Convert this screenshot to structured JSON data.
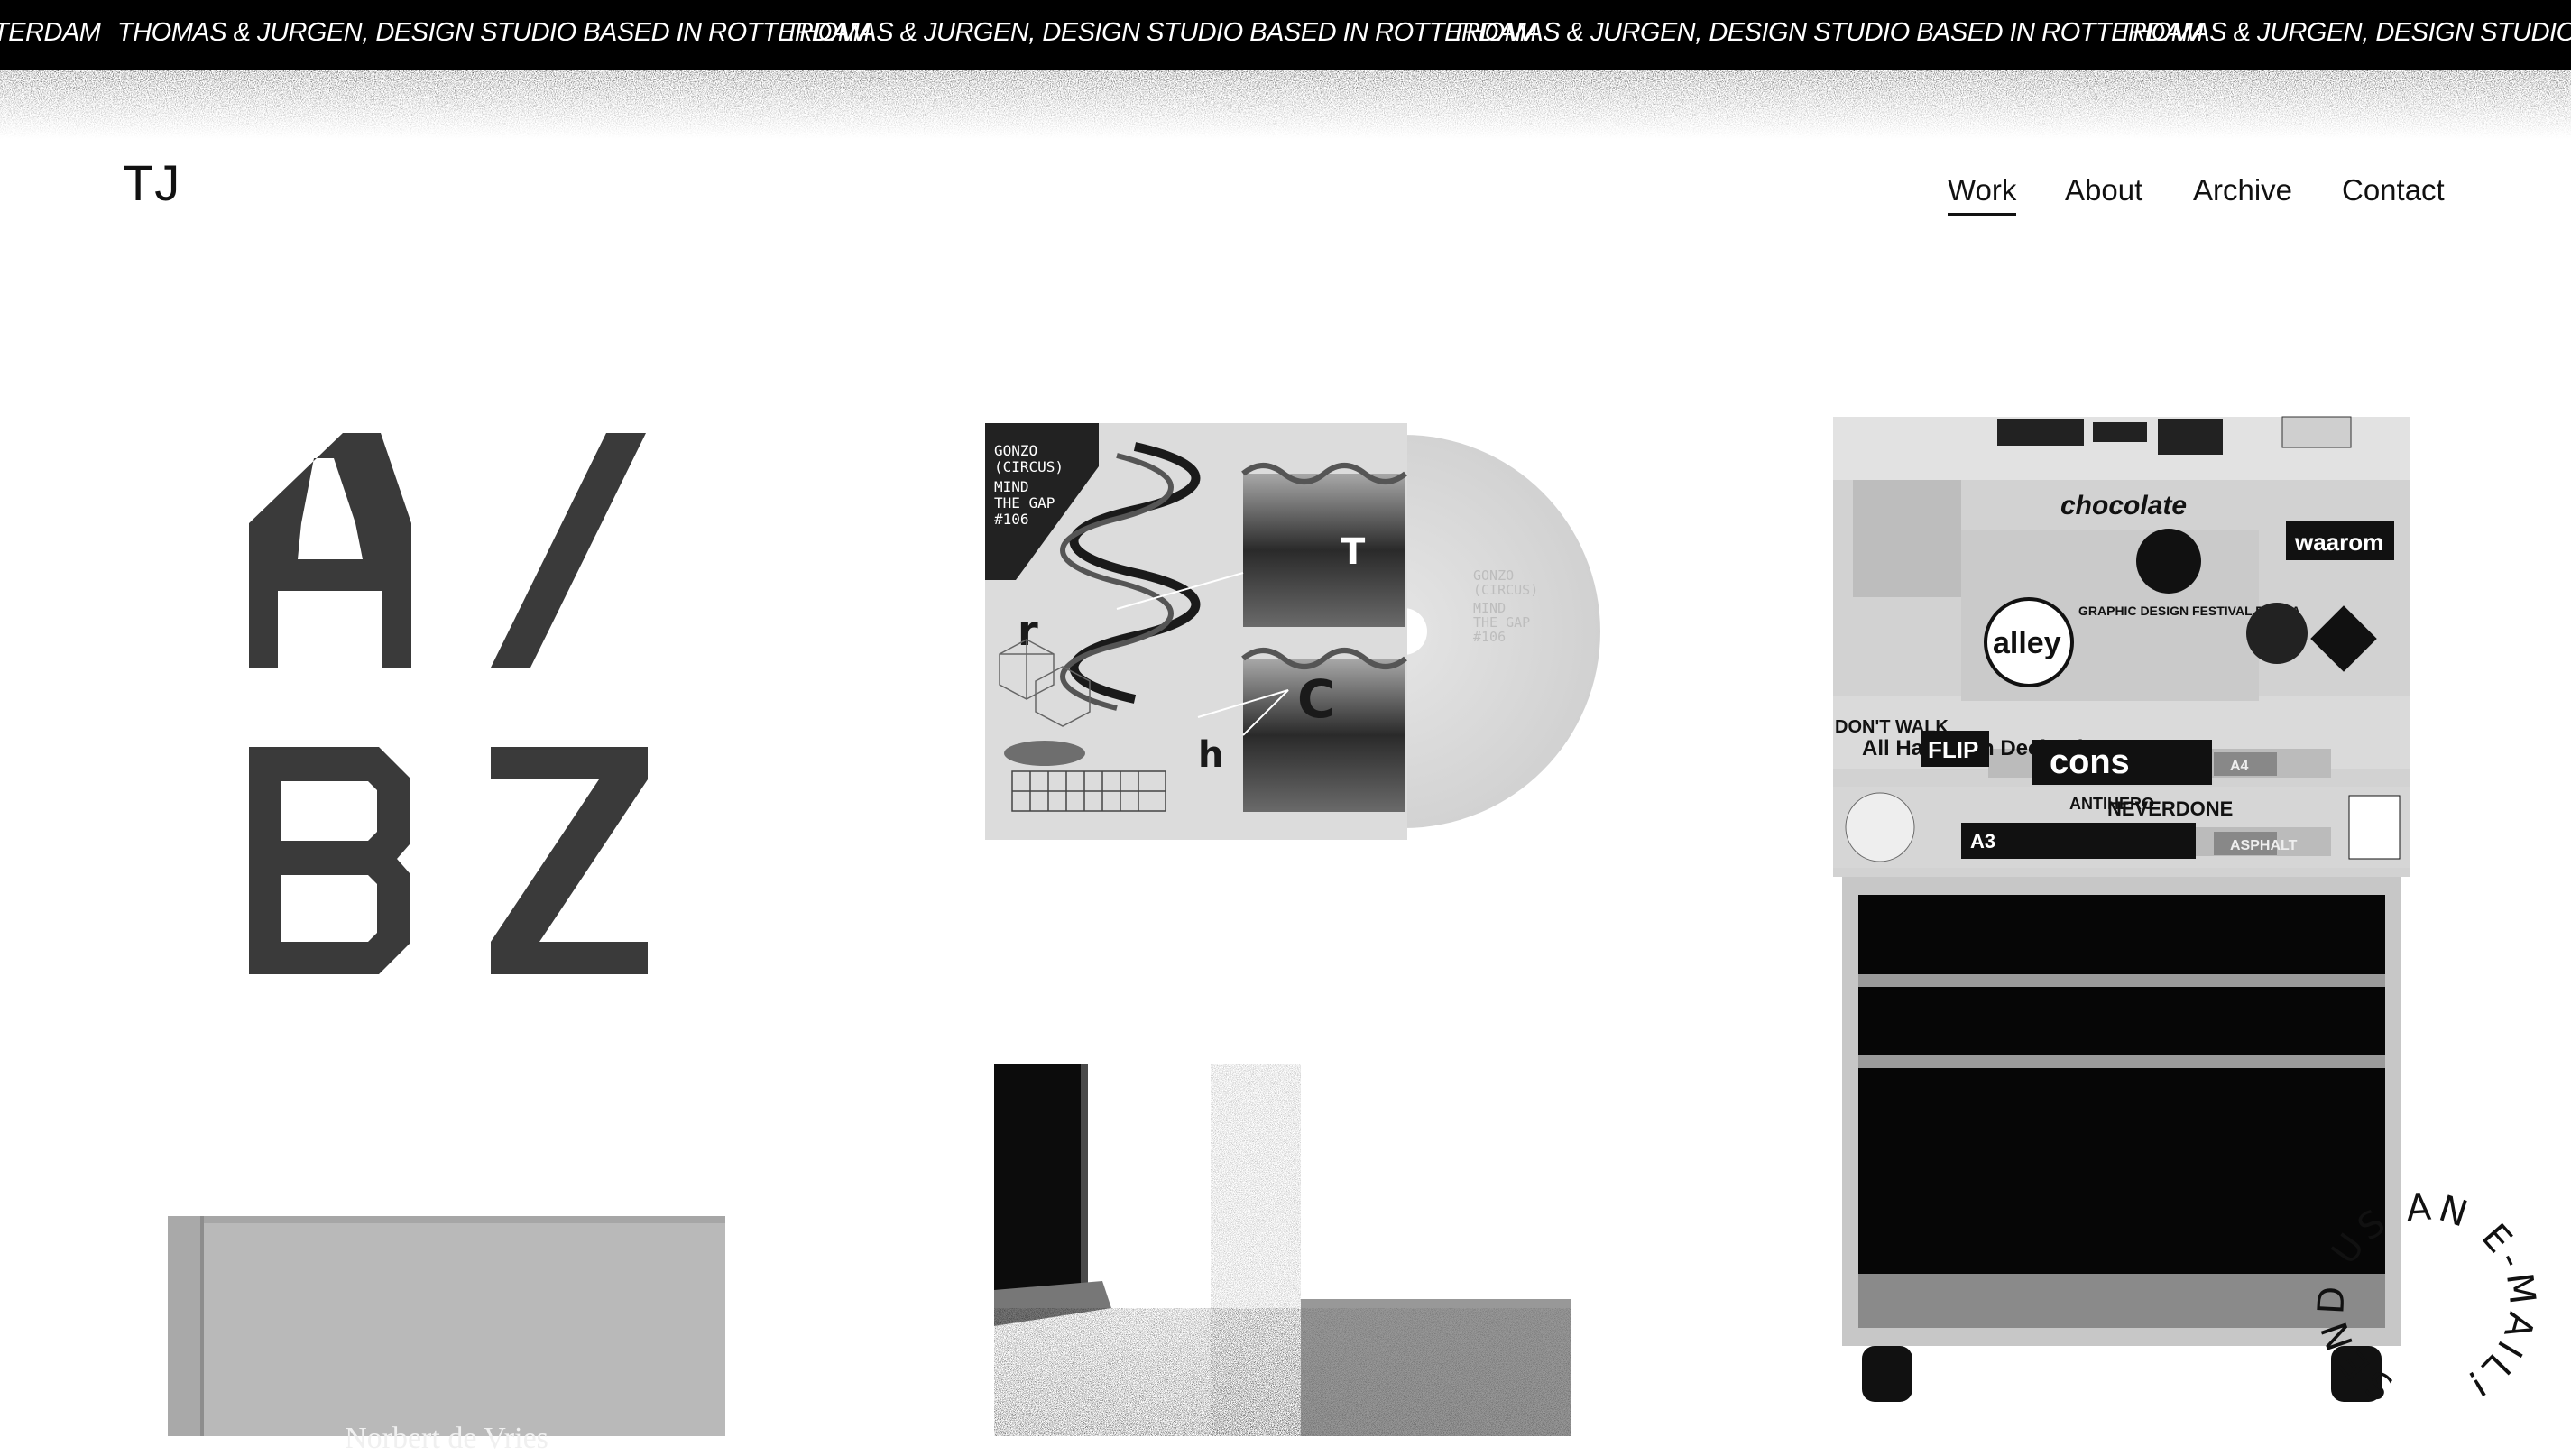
{
  "marquee": {
    "text": "THOMAS & JURGEN, DESIGN STUDIO BASED IN ROTTERDAM",
    "lead_fragment": "TERDAM",
    "tail_fragment": "THOMAS & JURGEN, DESIGN STUDIO BASE"
  },
  "header": {
    "logo": "TJ",
    "nav": [
      {
        "label": "Work",
        "active": true
      },
      {
        "label": "About",
        "active": false
      },
      {
        "label": "Archive",
        "active": false
      },
      {
        "label": "Contact",
        "active": false
      }
    ]
  },
  "projects": {
    "az_letters": [
      "A",
      "/",
      "B",
      "Z"
    ],
    "cd_sleeve": {
      "lines": [
        "GONZO",
        "(CIRCUS)",
        "MIND",
        "THE GAP",
        "#106"
      ],
      "glyphs": [
        "r",
        "T",
        "h",
        "C"
      ]
    },
    "copier_stickers": [
      "chocolate",
      "waarom",
      "alley",
      "GRAPHIC DESIGN FESTIVAL BREDA",
      "ANTIHERO",
      "All Hands on Deck .nl",
      "FLIP",
      "DON'T WALK",
      "NEVERDONE",
      "cons",
      "A4",
      "A3",
      "ASPHALT"
    ],
    "book_title": "Norbert de Vries"
  },
  "circle_cta": {
    "text": "SEND US AN E-MAIL! "
  },
  "colors": {
    "ink": "#111111",
    "marquee_bg": "#000000",
    "letter_grey": "#3a3a3a",
    "page_bg": "#ffffff"
  }
}
